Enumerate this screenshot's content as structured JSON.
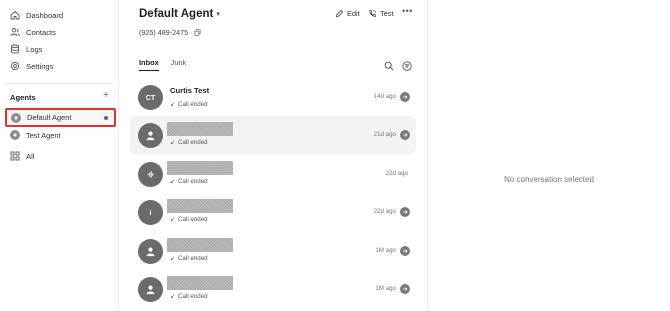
{
  "sidebar": {
    "nav": [
      {
        "label": "Dashboard",
        "icon": "home-icon"
      },
      {
        "label": "Contacts",
        "icon": "contacts-icon"
      },
      {
        "label": "Logs",
        "icon": "database-icon"
      },
      {
        "label": "Settings",
        "icon": "gear-icon"
      }
    ],
    "agents_header": "Agents",
    "agents_add": "+",
    "agents": [
      {
        "label": "Default Agent",
        "selected": true
      },
      {
        "label": "Test Agent",
        "selected": false
      }
    ],
    "all_label": "All"
  },
  "header": {
    "agent_name": "Default Agent",
    "edit_label": "Edit",
    "test_label": "Test",
    "more_label": "•••",
    "phone": "(925) 489-2475"
  },
  "tabs": [
    {
      "label": "Inbox",
      "active": true
    },
    {
      "label": "Junk",
      "active": false
    }
  ],
  "conversations": [
    {
      "avatar": "CT",
      "avatar_kind": "initials",
      "name": "Curtis Test",
      "status": "Call ended",
      "time": "14d ago"
    },
    {
      "avatar": "",
      "avatar_kind": "person",
      "name": "",
      "status": "Call ended",
      "time": "21d ago"
    },
    {
      "avatar": "",
      "avatar_kind": "audio",
      "name": "",
      "status": "Call ended",
      "time": "22d ago"
    },
    {
      "avatar": "I",
      "avatar_kind": "initials",
      "name": "",
      "status": "Call ended",
      "time": "22d ago"
    },
    {
      "avatar": "",
      "avatar_kind": "person",
      "name": "",
      "status": "Call ended",
      "time": "1M ago"
    },
    {
      "avatar": "",
      "avatar_kind": "person",
      "name": "",
      "status": "Call ended",
      "time": "1M ago"
    }
  ],
  "empty_state": "No conversation selected",
  "colors": {
    "highlight_border": "#e0342a",
    "active_dot": "#2d6ae3"
  }
}
